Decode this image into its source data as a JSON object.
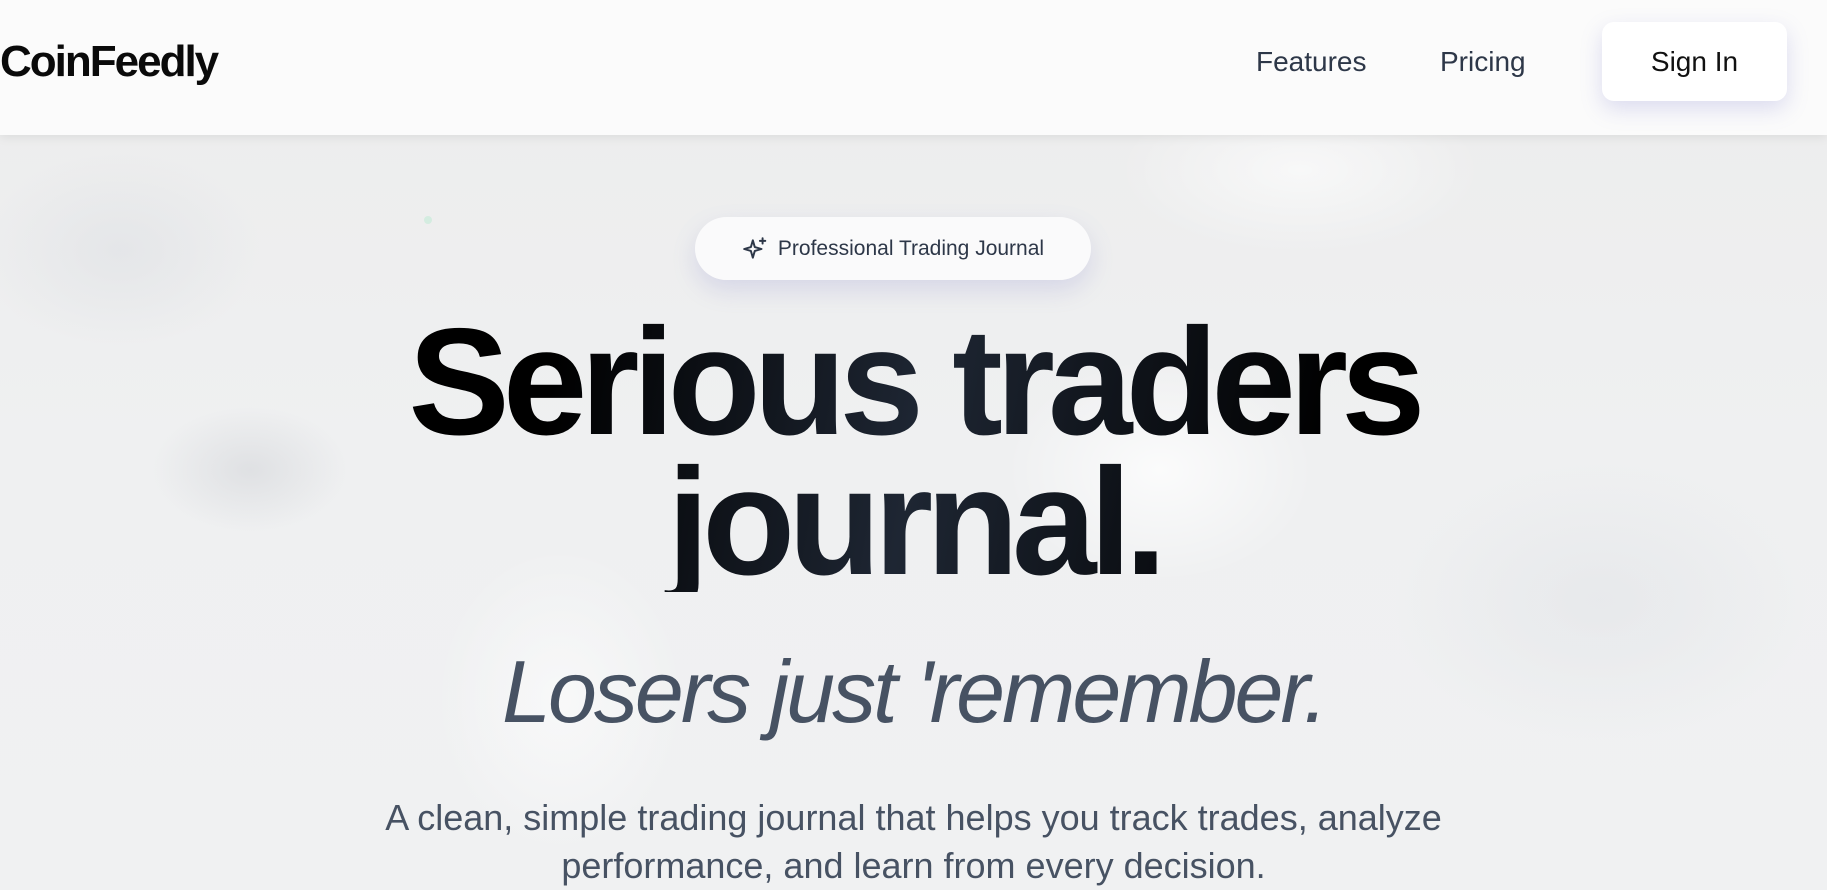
{
  "nav": {
    "logo": "CoinFeedly",
    "links": [
      {
        "label": "Features"
      },
      {
        "label": "Pricing"
      }
    ],
    "signin_label": "Sign In"
  },
  "hero": {
    "badge": {
      "icon": "sparkles-icon",
      "text": "Professional Trading Journal"
    },
    "headline_line1": "Serious traders",
    "headline_line2": "journal.",
    "tagline": "Losers just 'remember.",
    "description_line1": "A clean, simple trading journal that helps you track trades, analyze",
    "description_line2": "performance, and learn from every decision."
  },
  "colors": {
    "text_dark": "#0a0a0a",
    "text_muted": "#475263",
    "nav_link": "#2d3748",
    "background": "#eef0f2",
    "button_bg": "#ffffff"
  }
}
